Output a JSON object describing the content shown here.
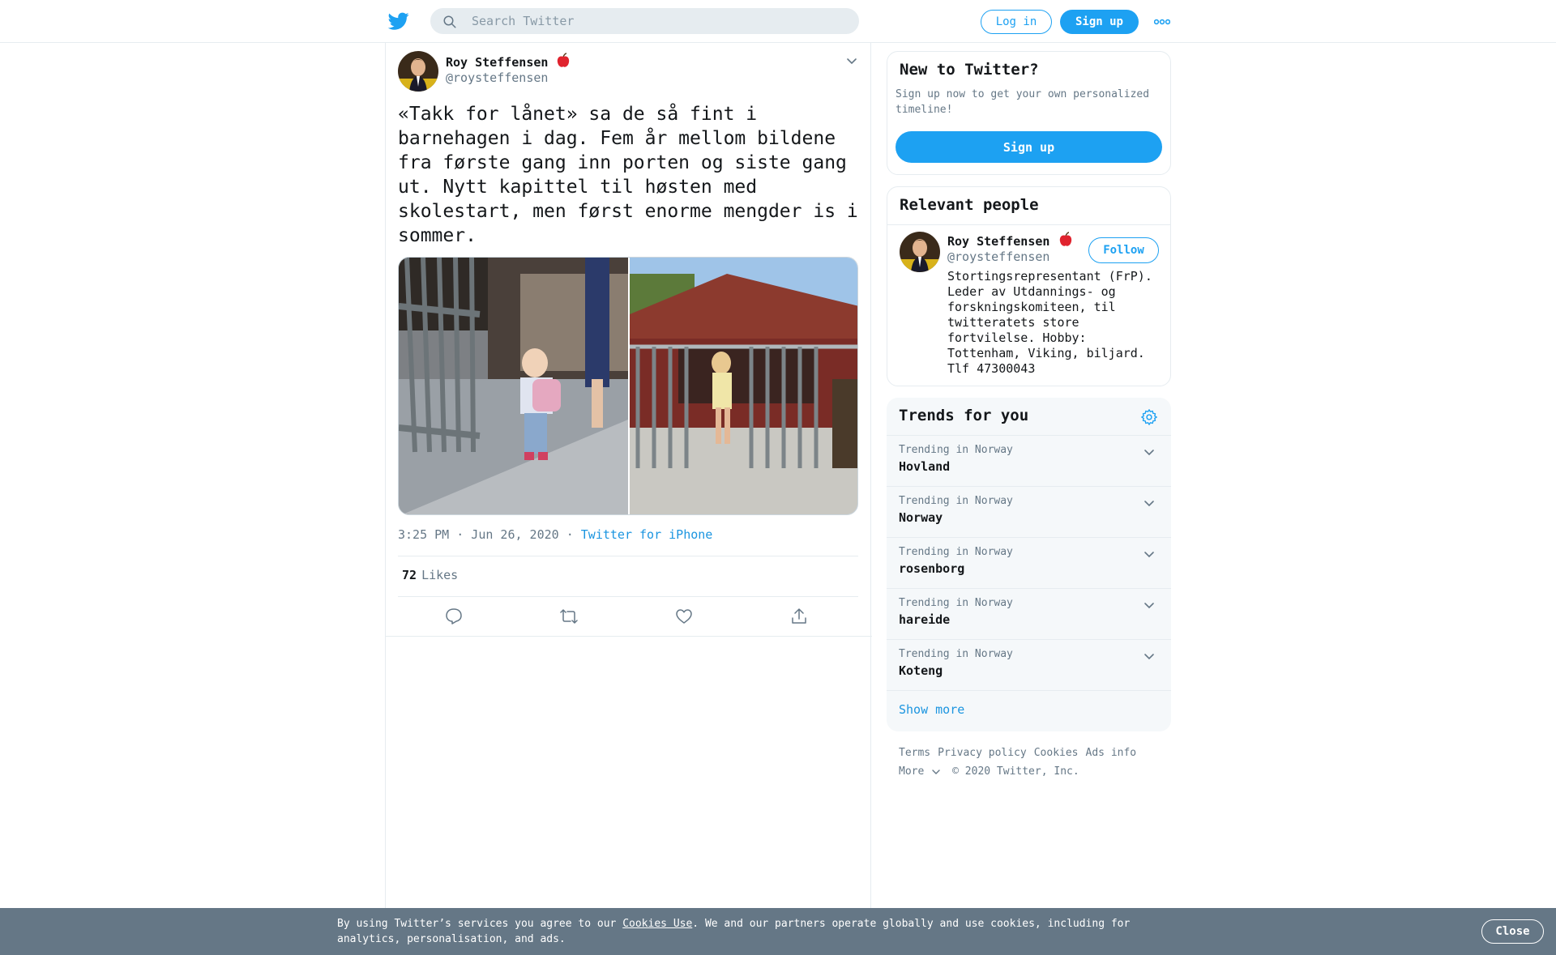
{
  "header": {
    "search_placeholder": "Search Twitter",
    "login_label": "Log in",
    "signup_label": "Sign up",
    "icons": {
      "logo": "twitter-bird-icon",
      "search": "search-icon",
      "more": "more-dots-icon"
    }
  },
  "tweet": {
    "author_name": "Roy Steffensen",
    "author_emoji": "🍎",
    "author_handle": "@roysteffensen",
    "text": "«Takk for lånet» sa de så fint i barnehagen i dag. Fem år mellom bildene fra første gang inn porten og siste gang ut. Nytt kapittel til høsten med skolestart, men først enorme mengder is i sommer.",
    "timestamp": "3:25 PM · Jun 26, 2020",
    "separator": " · ",
    "source": "Twitter for iPhone",
    "likes_count": "72",
    "likes_label": "Likes",
    "actions": [
      "reply-icon",
      "retweet-icon",
      "like-icon",
      "share-icon"
    ]
  },
  "new_to_twitter": {
    "title": "New to Twitter?",
    "description": "Sign up now to get your own personalized timeline!",
    "button_label": "Sign up"
  },
  "relevant_people": {
    "title": "Relevant people",
    "name": "Roy Steffensen",
    "emoji": "🍎",
    "handle": "@roysteffensen",
    "follow_label": "Follow",
    "bio": "Stortingsrepresentant (FrP). Leder av Utdannings- og forskningskomiteen, til twitteratets store fortvilelse. Hobby: Tottenham, Viking, biljard. Tlf 47300043"
  },
  "trends": {
    "title": "Trends for you",
    "items": [
      {
        "context": "Trending in Norway",
        "name": "Hovland"
      },
      {
        "context": "Trending in Norway",
        "name": "Norway"
      },
      {
        "context": "Trending in Norway",
        "name": "rosenborg"
      },
      {
        "context": "Trending in Norway",
        "name": "hareide"
      },
      {
        "context": "Trending in Norway",
        "name": "Koteng"
      }
    ],
    "show_more": "Show more"
  },
  "footer": {
    "links": [
      "Terms",
      "Privacy policy",
      "Cookies",
      "Ads info"
    ],
    "more_label": "More",
    "copyright": "© 2020 Twitter, Inc."
  },
  "cookie_bar": {
    "text_before": "By using Twitter’s services you agree to our ",
    "link_label": "Cookies Use",
    "text_after": ". We and our partners operate globally and use cookies, including for analytics, personalisation, and ads.",
    "close_label": "Close"
  },
  "colors": {
    "accent": "#1da1f2",
    "link": "#1b95e0",
    "muted": "#657786",
    "cookie_bar": "#657786"
  }
}
